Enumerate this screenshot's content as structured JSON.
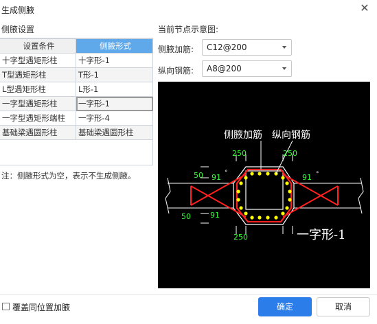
{
  "dialog": {
    "title": "生成侧腋",
    "close_icon": "close-icon"
  },
  "left": {
    "section_title": "侧腋设置",
    "columns": [
      "设置条件",
      "侧腋形式"
    ],
    "rows": [
      [
        "十字型遇矩形柱",
        "十字形-1"
      ],
      [
        "T型遇矩形柱",
        "T形-1"
      ],
      [
        "L型遇矩形柱",
        "L形-1"
      ],
      [
        "一字型遇矩形柱",
        "一字形-1"
      ],
      [
        "一字型遇矩形端柱",
        "一字形-4"
      ],
      [
        "基础梁遇圆形柱",
        "基础梁遇圆形柱"
      ]
    ],
    "selected_row": 3,
    "note": "注：侧腋形式为空，表示不生成侧腋。"
  },
  "right": {
    "section_title": "当前节点示意图:",
    "haunch_rebar_label": "侧腋加筋:",
    "haunch_rebar_value": "C12@200",
    "long_rebar_label": "纵向钢筋:",
    "long_rebar_value": "A8@200"
  },
  "diagram": {
    "label_haunch": "侧腋加筋",
    "label_long": "纵向钢筋",
    "dim_top_left": "250",
    "dim_top_right": "250",
    "dim_bottom": "250",
    "dim_left_50_top": "50",
    "dim_left_50_bottom": "50",
    "angle_91_top_left": "91",
    "angle_91_top_right": "91",
    "angle_91_bottom": "91",
    "deg_top_left": "°",
    "deg_top_right": "°",
    "type_label": "一字形-1",
    "colors": {
      "background": "#000000",
      "rebar": "#ff2020",
      "bars": "#ffff00",
      "lines": "#ffffff",
      "dims": "#39ff39"
    }
  },
  "footer": {
    "checkbox_label": "覆盖同位置加腋",
    "checkbox_checked": false,
    "ok_label": "确定",
    "cancel_label": "取消"
  },
  "accent": "#5fa8ea",
  "primary_button": "#2b7de9"
}
